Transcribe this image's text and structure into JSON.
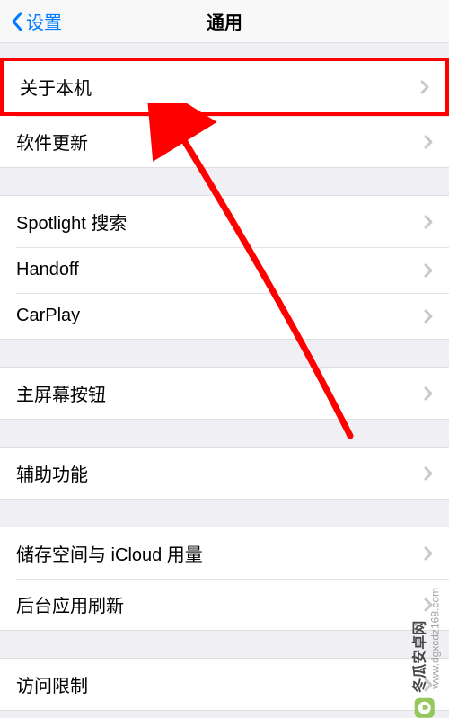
{
  "header": {
    "back_label": "设置",
    "title": "通用"
  },
  "sections": [
    {
      "rows": [
        {
          "label": "关于本机",
          "highlighted": true
        },
        {
          "label": "软件更新"
        }
      ]
    },
    {
      "rows": [
        {
          "label": "Spotlight 搜索"
        },
        {
          "label": "Handoff"
        },
        {
          "label": "CarPlay"
        }
      ]
    },
    {
      "rows": [
        {
          "label": "主屏幕按钮"
        }
      ]
    },
    {
      "rows": [
        {
          "label": "辅助功能"
        }
      ]
    },
    {
      "rows": [
        {
          "label": "储存空间与 iCloud 用量"
        },
        {
          "label": "后台应用刷新"
        }
      ]
    },
    {
      "rows": [
        {
          "label": "访问限制"
        }
      ]
    }
  ],
  "watermark": {
    "title": "冬瓜安卓网",
    "url": "www.dgxcdz168.com"
  },
  "annotation": {
    "arrow_color": "#ff0000"
  }
}
